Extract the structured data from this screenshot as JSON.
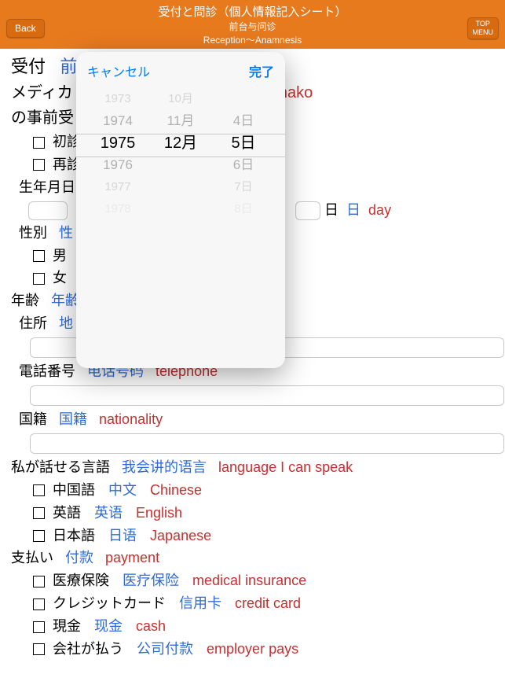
{
  "header": {
    "back": "Back",
    "top_menu_l1": "TOP",
    "top_menu_l2": "MENU",
    "title": "受付と問診（個人情報記入シート）",
    "sub1": "前台与问诊",
    "sub2": "Reception～Anamnesis"
  },
  "section_title": {
    "jp": "受付",
    "cn_partial": "前"
  },
  "name_card": {
    "l1_jp": "メディカ",
    "l1_en_partial": "anako",
    "l2_jp": "の事前受"
  },
  "visits": {
    "first": {
      "jp": "初診"
    },
    "return": {
      "jp": "再診"
    }
  },
  "dob": {
    "label_jp": "生年月日",
    "day_jp": "日",
    "day_cn": "日",
    "day_en": "day"
  },
  "sex": {
    "label_jp": "性別",
    "label_cn_partial": "性",
    "male_jp": "男",
    "female_jp": "女"
  },
  "age": {
    "label_jp": "年齢",
    "label_cn_partial": "年齢"
  },
  "address": {
    "label_jp": "住所",
    "label_cn_partial": "地"
  },
  "tel": {
    "label_jp": "電話番号",
    "label_cn": "电话号码",
    "label_en": "telephone"
  },
  "nat": {
    "label_jp": "国籍",
    "label_cn": "国籍",
    "label_en": "nationality"
  },
  "lang": {
    "label_jp": "私が話せる言語",
    "label_cn": "我会讲的语言",
    "label_en": "language I can speak",
    "cn_jp": "中国語",
    "cn_cn": "中文",
    "cn_en": "Chinese",
    "en_jp": "英語",
    "en_cn": "英语",
    "en_en": "English",
    "jp_jp": "日本語",
    "jp_cn": "日语",
    "jp_en": "Japanese"
  },
  "pay": {
    "label_jp": "支払い",
    "label_cn": "付款",
    "label_en": "payment",
    "ins_jp": "医療保険",
    "ins_cn": "医疗保险",
    "ins_en": "medical insurance",
    "cc_jp": "クレジットカード",
    "cc_cn": "信用卡",
    "cc_en": "credit card",
    "cash_jp": "現金",
    "cash_cn": "现金",
    "cash_en": "cash",
    "emp_jp": "会社が払う",
    "emp_cn": "公司付款",
    "emp_en": "employer pays"
  },
  "picker": {
    "cancel": "キャンセル",
    "done": "完了",
    "years": [
      "1973",
      "1974",
      "1975",
      "1976",
      "1977",
      "1978"
    ],
    "months": [
      "10月",
      "11月",
      "12月",
      "",
      ""
    ],
    "days": [
      "",
      "4日",
      "5日",
      "6日",
      "7日",
      "8日"
    ],
    "sel_year": "1975",
    "sel_month": "12月",
    "sel_day": "5日"
  }
}
